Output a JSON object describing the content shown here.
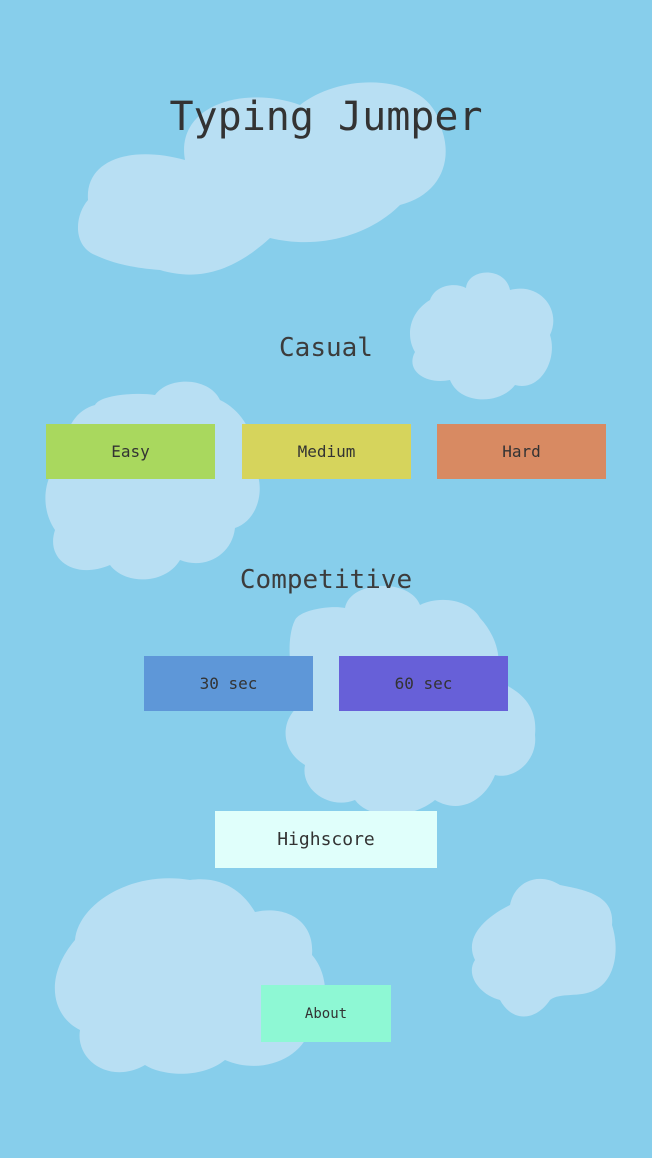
{
  "title": "Typing Jumper",
  "casual": {
    "heading": "Casual",
    "buttons": [
      {
        "label": "Easy",
        "color": "#a9d85e"
      },
      {
        "label": "Medium",
        "color": "#d6d45c"
      },
      {
        "label": "Hard",
        "color": "#d88a62"
      }
    ]
  },
  "competitive": {
    "heading": "Competitive",
    "buttons": [
      {
        "label": "30 sec",
        "color": "#5e97d8"
      },
      {
        "label": "60 sec",
        "color": "#6760d8"
      }
    ]
  },
  "highscore": {
    "label": "Highscore",
    "color": "#e0fffb"
  },
  "about": {
    "label": "About",
    "color": "#8ef8d4"
  },
  "colors": {
    "background": "#87ceeb",
    "cloud": "#b8dff3",
    "text": "#333333"
  }
}
